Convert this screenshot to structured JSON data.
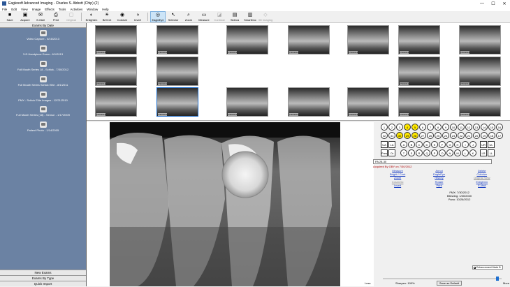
{
  "window": {
    "title": "Eaglesoft Advanced Imaging - Charles S. Abbott (Chip) (2)"
  },
  "menu": [
    "File",
    "Edit",
    "View",
    "Image",
    "Effects",
    "Tools",
    "Activities",
    "Window",
    "Help"
  ],
  "toolbar": {
    "left": [
      {
        "label": "Save",
        "icon": "save-icon",
        "glyph": "■",
        "disabled": false
      },
      {
        "label": "Acquire",
        "icon": "acquire-icon",
        "glyph": "▣",
        "disabled": false
      },
      {
        "label": "E-Mail",
        "icon": "email-icon",
        "glyph": "✉",
        "disabled": false
      },
      {
        "label": "Print",
        "icon": "print-icon",
        "glyph": "⎙",
        "disabled": false
      },
      {
        "label": "Original",
        "icon": "original-icon",
        "glyph": "▢",
        "disabled": true
      }
    ],
    "middle": [
      {
        "label": "Enlighten",
        "icon": "enlighten-icon",
        "glyph": "◐",
        "disabled": false
      },
      {
        "label": "Brt/Cnt",
        "icon": "brightness-icon",
        "glyph": "☀",
        "disabled": false
      },
      {
        "label": "Colorize",
        "icon": "colorize-icon",
        "glyph": "◉",
        "disabled": false
      },
      {
        "label": "Invert",
        "icon": "invert-icon",
        "glyph": "◑",
        "disabled": false
      }
    ],
    "right": [
      {
        "label": "EagleEye",
        "icon": "eagleeye-icon",
        "glyph": "◎",
        "disabled": false,
        "active": true
      },
      {
        "label": "Selector",
        "icon": "selector-icon",
        "glyph": "↖",
        "disabled": false
      },
      {
        "label": "Zoom",
        "icon": "zoom-icon",
        "glyph": "⌕",
        "disabled": false
      },
      {
        "label": "Measure",
        "icon": "measure-icon",
        "glyph": "▭",
        "disabled": false
      },
      {
        "label": "Contrast",
        "icon": "contrast-icon",
        "glyph": "◪",
        "disabled": true
      },
      {
        "label": "Sideva",
        "icon": "sideva-icon",
        "glyph": "▤",
        "disabled": false
      },
      {
        "label": "SmartDoc",
        "icon": "smartdoc-icon",
        "glyph": "▥",
        "disabled": false
      },
      {
        "label": "3D Imaging",
        "icon": "3d-imaging-icon",
        "glyph": "◇",
        "disabled": true
      }
    ]
  },
  "sidebar": {
    "header": "Exams By Date",
    "exams": [
      "Video Capture - 5/16/2013",
      "3-D Handpiece Exam - 6/1/2013",
      "Full Mouth Series 18 - Schick - 7/30/2012",
      "Full Mouth Series Schick Elite - 8/1/2011",
      "PMX - Schick Elite Images - 12/21/2010",
      "Full Mouth Series (18) - Sensor - 1/17/2009",
      "Patient Photo - 1/14/2005"
    ],
    "bottom_buttons": [
      "New Exams",
      "Exams By Type",
      "Quick Import"
    ]
  },
  "thumbnails": [
    {
      "date": "7/30/2012",
      "selected": false
    },
    {
      "date": "7/30/2012",
      "selected": false
    },
    {
      "date": "7/30/2012",
      "selected": false
    },
    {
      "date": "7/30/2012",
      "selected": false
    },
    {
      "date": "7/30/2012",
      "selected": false
    },
    {
      "date": "7/30/2012",
      "selected": false
    },
    {
      "date": "7/30/2012",
      "selected": false
    },
    {
      "date": "7/30/2012",
      "selected": false
    },
    {
      "date": "7/30/2012",
      "selected": false
    },
    {
      "date": "7/30/2012",
      "selected": false
    },
    {
      "date": "7/30/2012",
      "selected": false
    },
    {
      "date": "7/30/2012",
      "selected": false
    },
    {
      "date": "7/30/2012",
      "selected": false
    },
    {
      "date": "7/30/2012",
      "selected": true
    },
    {
      "date": "7/30/2012",
      "selected": false
    },
    {
      "date": "7/30/2012",
      "selected": false
    },
    {
      "date": "7/30/2012",
      "selected": false
    },
    {
      "date": "7/30/2012",
      "selected": false
    },
    {
      "date": "7/30/2012",
      "selected": false
    }
  ],
  "tooth_chart": {
    "upper": [
      "1",
      "2",
      "3",
      "4",
      "5",
      "6",
      "7",
      "8",
      "9",
      "10",
      "11",
      "12",
      "13",
      "14",
      "15",
      "16"
    ],
    "lower": [
      "32",
      "31",
      "30",
      "29",
      "28",
      "27",
      "26",
      "25",
      "24",
      "23",
      "22",
      "21",
      "20",
      "19",
      "18",
      "17"
    ],
    "highlighted": [
      "4",
      "5",
      "30",
      "29",
      "28"
    ],
    "row_ua": [
      "UA",
      "LA"
    ],
    "row_ul": [
      "UR",
      "UL"
    ],
    "row_lr": [
      "LR",
      "LL"
    ],
    "primary_upper": [
      "A",
      "B",
      "C",
      "D",
      "E",
      "F",
      "G",
      "H",
      "I",
      "J"
    ],
    "primary_lower": [
      "T",
      "S",
      "R",
      "Q",
      "P",
      "O",
      "N",
      "M",
      "L",
      "K"
    ],
    "perio": [
      "Pres",
      "Or"
    ]
  },
  "image_info": {
    "id": "PA 28-30",
    "acquired": "Acquired By GBY on 7/30/2012"
  },
  "links": {
    "col1": [
      "Measure",
      "Bright / Cont",
      "Zoom",
      "Cosmetic",
      "Invert"
    ],
    "col2": [
      "Annot",
      "EagleEye",
      "History",
      "Rotate",
      "Print"
    ],
    "col3": [
      "Delete",
      "Colorize",
      "Original View",
      "Enlighten",
      "E-Mail"
    ],
    "disabled": [
      "Cosmetic",
      "Original View"
    ]
  },
  "stats": [
    "FMX: 7/30/2012",
    "Bitewing: 1/30/2020",
    "Pano: 10/26/2012"
  ],
  "enhancement_mode": "Enhancement Mode B",
  "sharpen": {
    "less": "Less",
    "more": "More",
    "label": "Sharpen: 100%",
    "value_pct": 100
  },
  "save_default": "Save as Default"
}
